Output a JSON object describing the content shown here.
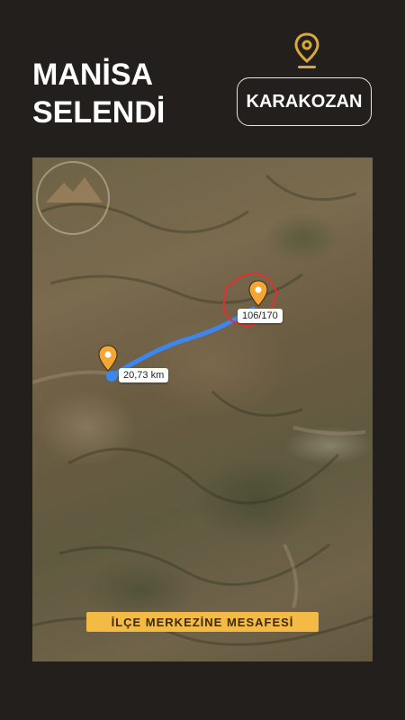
{
  "header": {
    "province": "MANİSA",
    "district": "SELENDİ",
    "village": "KARAKOZAN"
  },
  "map": {
    "parcel_label": "106/170",
    "distance_label": "20,73 km",
    "banner": "İLÇE MERKEZİNE MESAFESİ"
  },
  "colors": {
    "background": "#231f1c",
    "accent": "#f3bb46",
    "route": "#3c86f0",
    "parcel_border": "#e03030"
  },
  "icons": {
    "top_pin": "location-pin-icon",
    "map_pins": "location-pin-icon"
  }
}
